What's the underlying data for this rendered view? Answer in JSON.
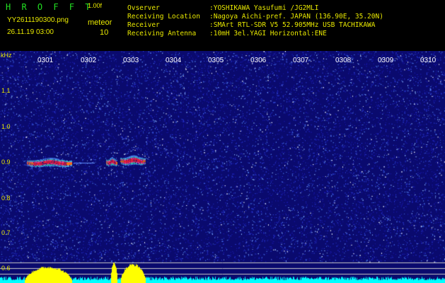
{
  "header": {
    "app_title": "H R O F F T",
    "version": "1.00f",
    "filename": "YY2611190300.png",
    "timestamp": "26.11.19 03:00",
    "meteor_label": "meteor",
    "meteor_count": "10",
    "info_lines": [
      {
        "label": "Ovserver",
        "value": ":YOSHIKAWA Yasufumi /JG2MLI"
      },
      {
        "label": "Receiving Location",
        "value": ":Nagoya Aichi-pref. JAPAN (136.90E, 35.20N)"
      },
      {
        "label": "Receiver",
        "value": ":SMArt RTL-SDR V5 52.905MHz USB TACHIKAWA"
      },
      {
        "label": "Receiving Antenna",
        "value": ":10mH 3el.YAGI Horizontal:ENE"
      }
    ]
  },
  "axis": {
    "y_unit": "kHz",
    "y_labels": [
      "1.1",
      "1.0",
      "0.9",
      "0.8",
      "0.7",
      "0.6"
    ],
    "x_labels": [
      "0301",
      "0302",
      "0303",
      "0304",
      "0305",
      "0306",
      "0307",
      "0308",
      "0309",
      "0310"
    ]
  },
  "colors": {
    "background": "#000000",
    "spectrum_bg": "#0a0a6e",
    "label_yellow": "#e8e800",
    "title_green": "#22e022",
    "power_trace": "#ffff00",
    "noise_floor": "#00ffff"
  }
}
